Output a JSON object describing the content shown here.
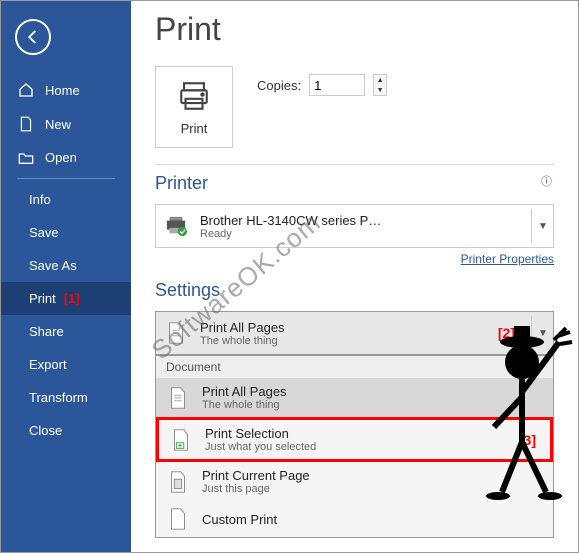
{
  "sidebar": {
    "items": [
      {
        "label": "Home"
      },
      {
        "label": "New"
      },
      {
        "label": "Open"
      },
      {
        "label": "Info"
      },
      {
        "label": "Save"
      },
      {
        "label": "Save As"
      },
      {
        "label": "Print"
      },
      {
        "label": "Share"
      },
      {
        "label": "Export"
      },
      {
        "label": "Transform"
      },
      {
        "label": "Close"
      }
    ]
  },
  "page": {
    "title": "Print"
  },
  "print_button": {
    "label": "Print"
  },
  "copies": {
    "label": "Copies:",
    "value": "1"
  },
  "printer_section": {
    "title": "Printer"
  },
  "printer": {
    "name": "Brother HL-3140CW series P…",
    "status": "Ready",
    "properties_link": "Printer Properties"
  },
  "settings_section": {
    "title": "Settings"
  },
  "settings_dropdown": {
    "title": "Print All Pages",
    "sub": "The whole thing"
  },
  "menu": {
    "header": "Document",
    "items": [
      {
        "title": "Print All Pages",
        "sub": "The whole thing"
      },
      {
        "title": "Print Selection",
        "sub": "Just what you selected"
      },
      {
        "title": "Print Current Page",
        "sub": "Just this page"
      },
      {
        "title": "Custom Print",
        "sub": ""
      }
    ]
  },
  "markers": {
    "m1": "[1]",
    "m2": "[2]",
    "m3": "[3]"
  },
  "watermark": "SoftwareOK.com"
}
